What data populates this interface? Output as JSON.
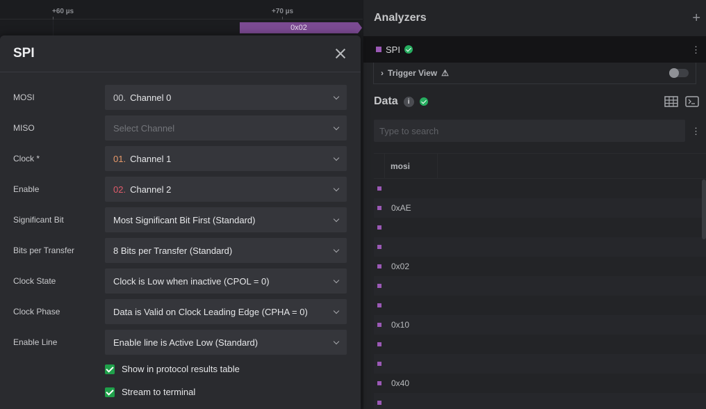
{
  "timeline": {
    "ticks": [
      "+60 µs",
      "+70 µs"
    ],
    "packet_label": "0x02"
  },
  "analyzers": {
    "title": "Analyzers",
    "add_icon": "plus-icon",
    "spi_label": "SPI",
    "spi_color": "#9b59b6",
    "trigger_label": "Trigger View",
    "data_title": "Data",
    "search_placeholder": "Type to search",
    "column": "mosi",
    "rows": [
      "",
      "0xAE",
      "",
      "",
      "0x02",
      "",
      "",
      "0x10",
      "",
      "",
      "0x40",
      ""
    ]
  },
  "modal": {
    "title": "SPI",
    "fields": [
      {
        "label": "MOSI",
        "num": "00.",
        "value": "Channel 0"
      },
      {
        "label": "MISO",
        "num": "",
        "value": "",
        "placeholder": "Select Channel"
      },
      {
        "label": "Clock *",
        "num": "01.",
        "value": "Channel 1"
      },
      {
        "label": "Enable",
        "num": "02.",
        "value": "Channel 2"
      },
      {
        "label": "Significant Bit",
        "num": "",
        "value": "Most Significant Bit First (Standard)"
      },
      {
        "label": "Bits per Transfer",
        "num": "",
        "value": "8 Bits per Transfer (Standard)"
      },
      {
        "label": "Clock State",
        "num": "",
        "value": "Clock is Low when inactive (CPOL = 0)"
      },
      {
        "label": "Clock Phase",
        "num": "",
        "value": "Data is Valid on Clock Leading Edge (CPHA = 0)"
      },
      {
        "label": "Enable Line",
        "num": "",
        "value": "Enable line is Active Low (Standard)"
      }
    ],
    "checkboxes": [
      {
        "label": "Show in protocol results table",
        "checked": true
      },
      {
        "label": "Stream to terminal",
        "checked": true
      }
    ]
  }
}
